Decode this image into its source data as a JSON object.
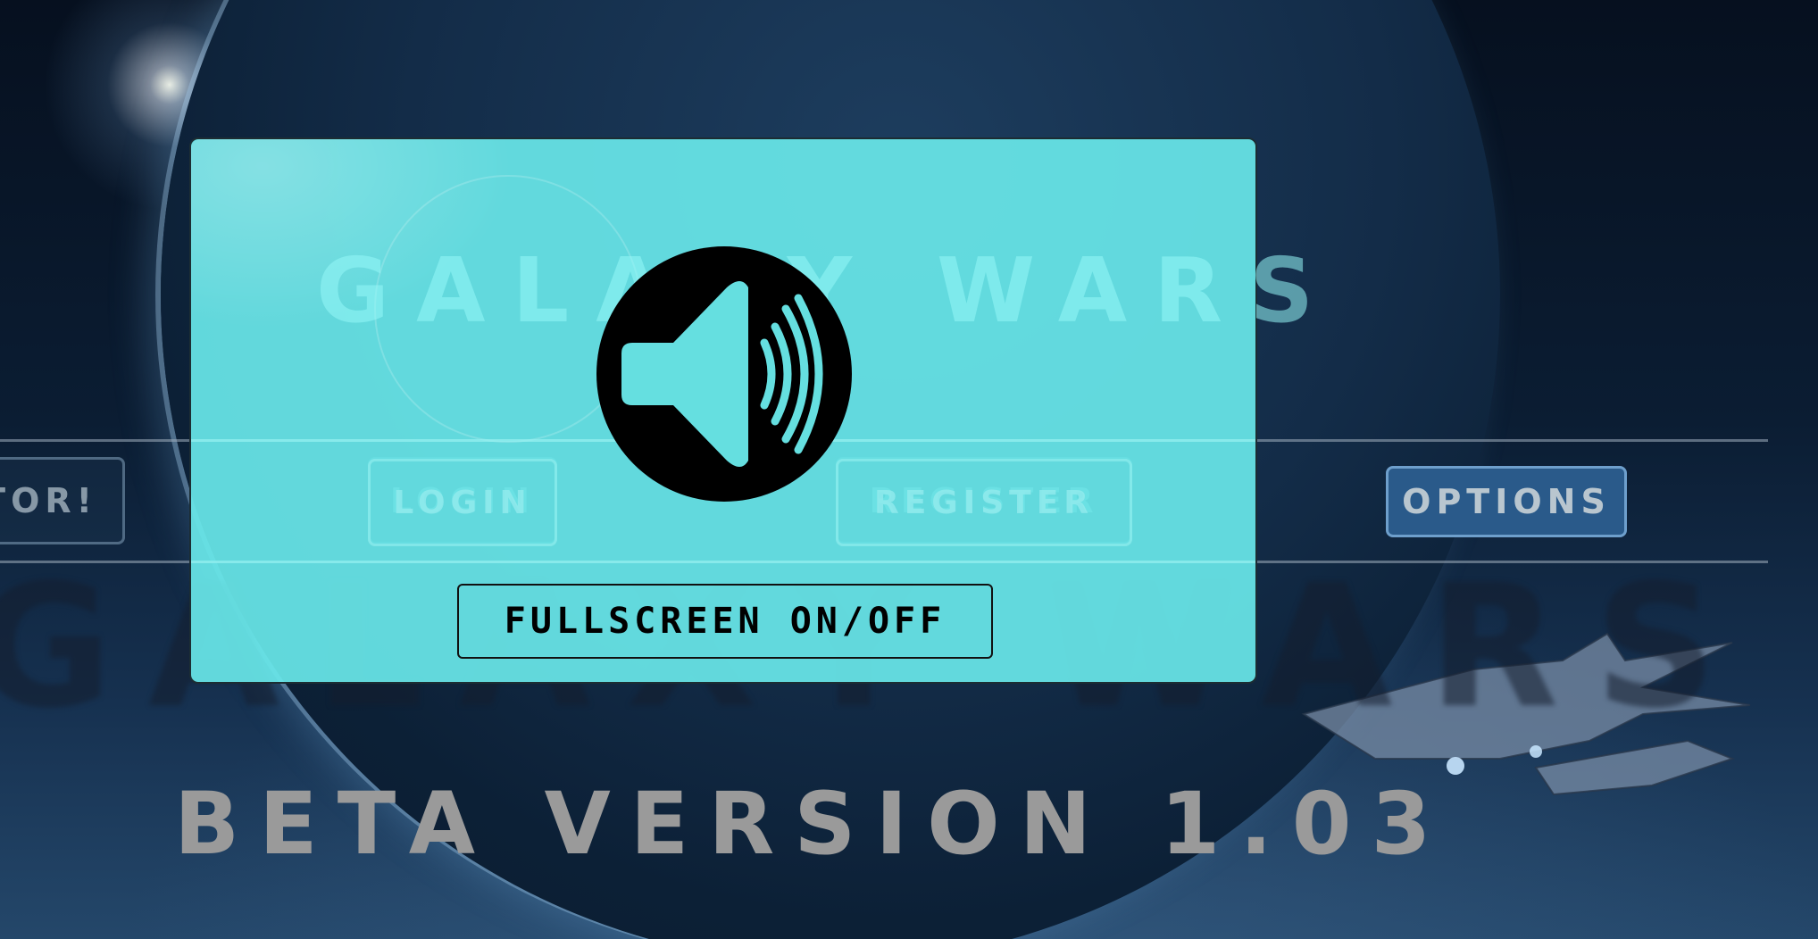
{
  "background": {
    "game_title": "GALAXY WARS",
    "version_label": "BETA VERSION 1.03"
  },
  "menu": {
    "tutorial_label": "TOR!",
    "login_label": "LOGIN",
    "register_label": "REGISTER",
    "options_label": "OPTIONS"
  },
  "options_panel": {
    "ghost_title": "GALAXY WARS",
    "sound_icon": "speaker-volume-icon",
    "fullscreen_label": "FULLSCREEN ON/OFF",
    "panel_color": "#68e6e8"
  }
}
